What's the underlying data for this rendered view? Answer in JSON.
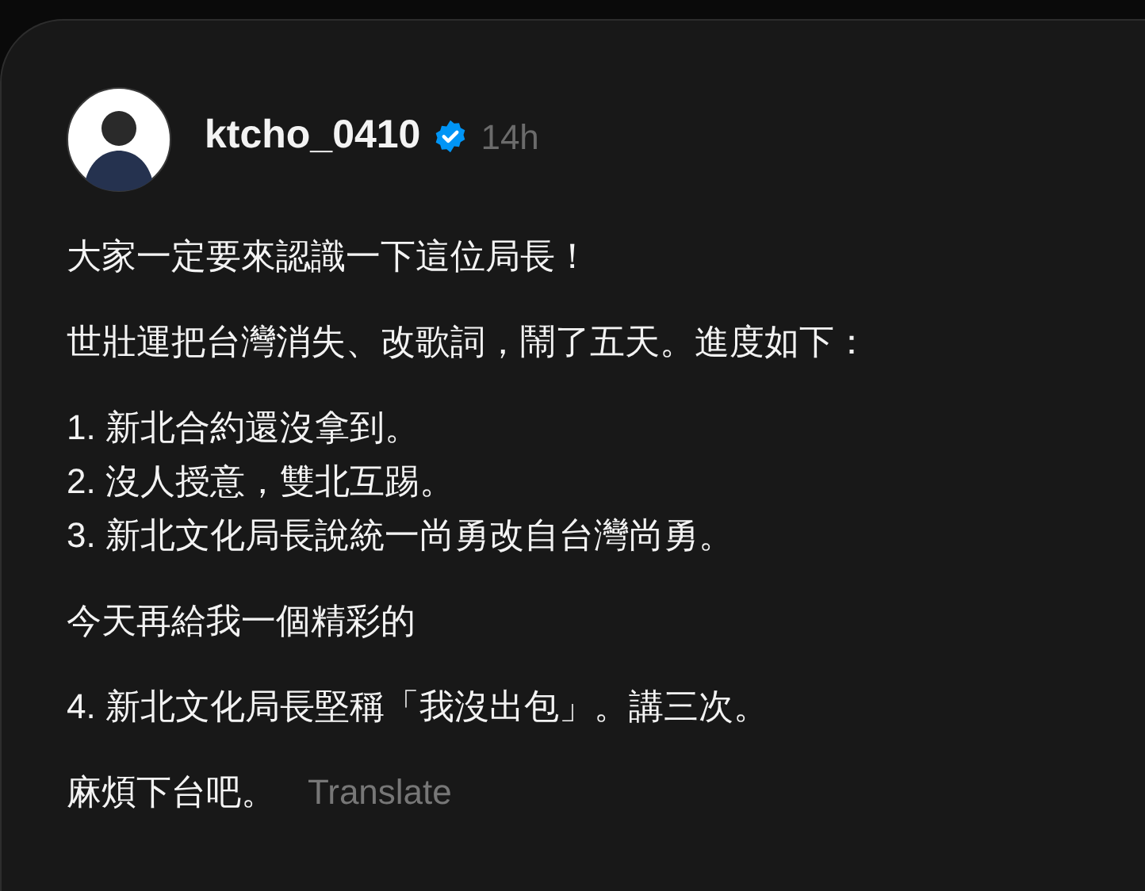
{
  "post": {
    "username": "ktcho_0410",
    "verified": true,
    "time": "14h",
    "paragraphs": [
      {
        "lines": [
          "大家一定要來認識一下這位局長！"
        ]
      },
      {
        "lines": [
          "世壯運把台灣消失、改歌詞，鬧了五天。進度如下："
        ]
      },
      {
        "lines": [
          "1. 新北合約還沒拿到。",
          "2. 沒人授意，雙北互踢。",
          "3. 新北文化局長說統一尚勇改自台灣尚勇。"
        ]
      },
      {
        "lines": [
          "今天再給我一個精彩的"
        ]
      },
      {
        "lines": [
          "4. 新北文化局長堅稱「我沒出包」。講三次。"
        ]
      },
      {
        "lines": [
          "麻煩下台吧。"
        ]
      }
    ],
    "translate": "Translate"
  }
}
